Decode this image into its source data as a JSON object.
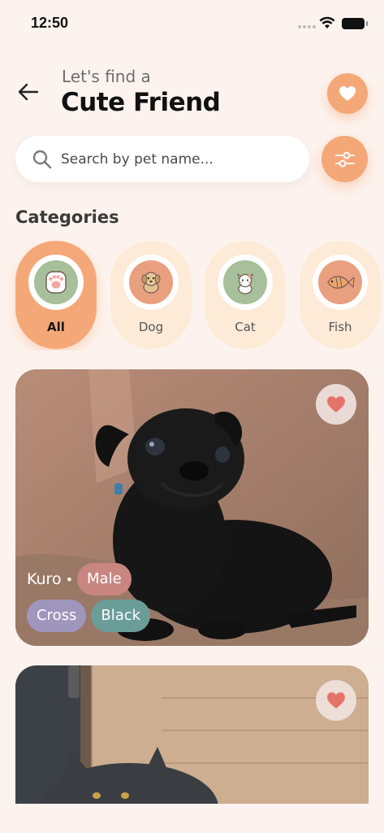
{
  "status_bar": {
    "time": "12:50"
  },
  "header": {
    "subtitle": "Let's find a",
    "title": "Cute Friend"
  },
  "search": {
    "placeholder": "Search by pet name..."
  },
  "categories": {
    "title": "Categories",
    "items": [
      {
        "label": "All",
        "icon": "paw-icon",
        "active": true
      },
      {
        "label": "Dog",
        "icon": "dog-icon",
        "active": false
      },
      {
        "label": "Cat",
        "icon": "cat-icon",
        "active": false
      },
      {
        "label": "Fish",
        "icon": "fish-icon",
        "active": false
      }
    ]
  },
  "pets": [
    {
      "name": "Kuro",
      "gender": "Male",
      "breed": "Cross",
      "color": "Black"
    },
    {
      "name": "",
      "gender": "",
      "breed": "",
      "color": ""
    }
  ],
  "colors": {
    "accent": "#f5a877",
    "background": "#fdf3ee",
    "category_bg": "#fdebd7",
    "tag_male": "#c98680",
    "tag_breed": "#9e96bd",
    "tag_color": "#6a9c98",
    "heart": "#e57369"
  }
}
